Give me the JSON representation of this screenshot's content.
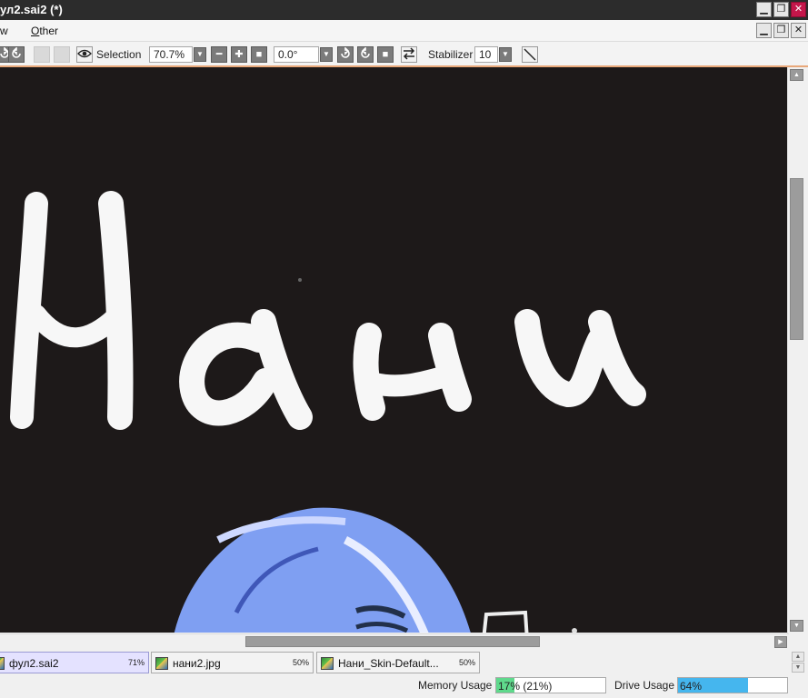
{
  "window": {
    "title": "ул2.sai2 (*)"
  },
  "menubar": {
    "items": [
      {
        "label": "w"
      },
      {
        "label": "Other",
        "accel": "O",
        "rest": "ther"
      }
    ]
  },
  "toolbar": {
    "selection_label": "Selection",
    "zoom_value": "70.7%",
    "rotation_value": "0.0°",
    "stabilizer_label": "Stabilizer",
    "stabilizer_value": "10"
  },
  "canvas": {
    "background": "#1d1919",
    "stroke_color": "#f7f7f7",
    "hair_color": "#7f9ff2"
  },
  "scrollbars": {
    "vertical": {
      "position": 0.2,
      "visible_fraction": 0.29
    },
    "horizontal": {
      "position": 0.31,
      "visible_fraction": 0.37
    }
  },
  "doc_tabs": [
    {
      "name": "фул2.sai2",
      "zoom": "71%",
      "active": true
    },
    {
      "name": "нани2.jpg",
      "zoom": "50%",
      "active": false
    },
    {
      "name": "Нани_Skin-Default...",
      "zoom": "50%",
      "active": false
    }
  ],
  "status": {
    "memory_label": "Memory Usage",
    "memory_value": "17%",
    "memory_extra": "(21%)",
    "memory_fraction": 0.17,
    "drive_label": "Drive Usage",
    "drive_value": "64%",
    "drive_fraction": 0.64
  },
  "colors": {
    "accent": "#e8a87a",
    "close": "#c4164a",
    "memory_fill": "#5fd98c",
    "drive_fill": "#45b6ee"
  }
}
